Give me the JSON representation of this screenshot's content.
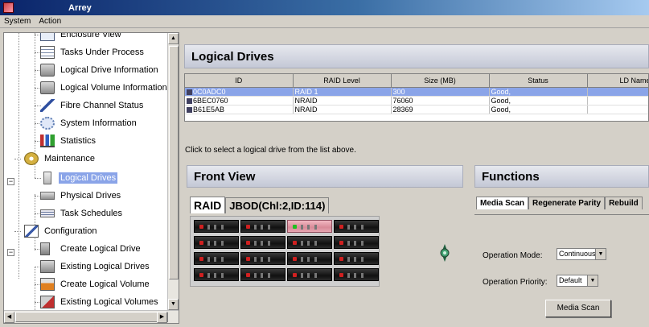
{
  "window": {
    "title": "Arrey"
  },
  "menu": [
    "System",
    "Action"
  ],
  "tree": {
    "items": [
      {
        "label": "Enclosure View",
        "icon": "window-icon"
      },
      {
        "label": "Tasks Under Process",
        "icon": "tasks-icon"
      },
      {
        "label": "Logical Drive Information",
        "icon": "drive-info-icon"
      },
      {
        "label": "Logical Volume Information",
        "icon": "volume-info-icon"
      },
      {
        "label": "Fibre Channel Status",
        "icon": "fibre-icon"
      },
      {
        "label": "System Information",
        "icon": "system-info-icon"
      },
      {
        "label": "Statistics",
        "icon": "statistics-icon"
      },
      {
        "label": "Maintenance",
        "icon": "gear-icon"
      },
      {
        "label": "Logical Drives",
        "icon": "logical-drive-icon",
        "selected": true
      },
      {
        "label": "Physical Drives",
        "icon": "physical-drive-icon"
      },
      {
        "label": "Task Schedules",
        "icon": "schedule-icon"
      },
      {
        "label": "Configuration",
        "icon": "configuration-icon"
      },
      {
        "label": "Create Logical Drive",
        "icon": "create-drive-icon"
      },
      {
        "label": "Existing Logical Drives",
        "icon": "existing-drives-icon"
      },
      {
        "label": "Create Logical Volume",
        "icon": "create-volume-icon"
      },
      {
        "label": "Existing Logical Volumes",
        "icon": "existing-volumes-icon"
      }
    ],
    "expander_symbol": "−"
  },
  "logical_drives": {
    "title": "Logical Drives",
    "columns": [
      "ID",
      "RAID Level",
      "Size (MB)",
      "Status",
      "LD Name"
    ],
    "rows": [
      {
        "id": "0C0ADC0",
        "raid": "RAID 1",
        "size": "300",
        "status": "Good,",
        "name": "",
        "selected": true
      },
      {
        "id": "6BEC0760",
        "raid": "NRAID",
        "size": "76060",
        "status": "Good,",
        "name": ""
      },
      {
        "id": "B61E5AB",
        "raid": "NRAID",
        "size": "28369",
        "status": "Good,",
        "name": ""
      }
    ],
    "hint": "Click to select a logical drive from the list above."
  },
  "front_view": {
    "title": "Front View",
    "tabs": [
      "RAID",
      "JBOD(Chl:2,ID:114)"
    ],
    "highlighted_drive": {
      "row": 1,
      "col": 3
    }
  },
  "functions": {
    "title": "Functions",
    "tabs": [
      "Media Scan",
      "Regenerate Parity",
      "Rebuild"
    ],
    "operation_mode_label": "Operation Mode:",
    "operation_mode_value": "Continuous",
    "operation_priority_label": "Operation Priority:",
    "operation_priority_value": "Default",
    "media_scan_button": "Media Scan"
  },
  "colors": {
    "selection": "#8aa4e8",
    "header_gradient_top": "#e6e8ee",
    "header_gradient_bottom": "#c4c8d6"
  }
}
